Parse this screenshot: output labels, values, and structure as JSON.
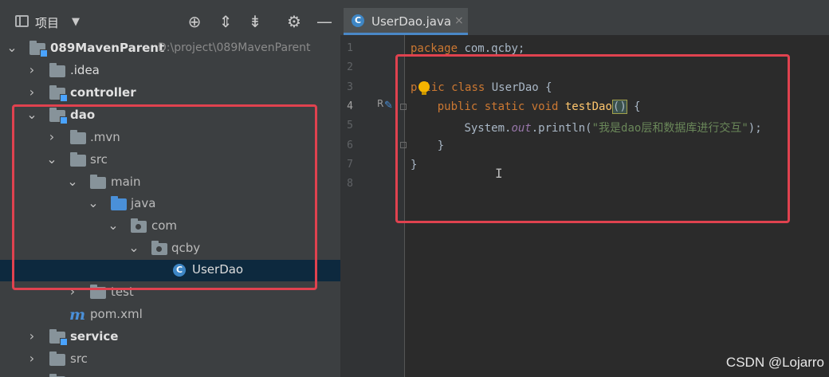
{
  "project_panel": {
    "title": "项目",
    "toolbar_icons": [
      "locate-icon",
      "expand-all-icon",
      "collapse-all-icon",
      "gear-icon",
      "minimize-icon"
    ]
  },
  "tree": {
    "root_label": "089MavenParent",
    "root_path": "D:\\project\\089MavenParent",
    "idea": ".idea",
    "controller": "controller",
    "dao": "dao",
    "mvn": ".mvn",
    "src": "src",
    "main": "main",
    "java": "java",
    "com": "com",
    "qcby": "qcby",
    "userdao": "UserDao",
    "test": "test",
    "pom": "pom.xml",
    "service": "service",
    "src2": "src"
  },
  "editor": {
    "tab_label": "UserDao.java",
    "tab_close": "×",
    "line_numbers": [
      "1",
      "2",
      "3",
      "4",
      "5",
      "6",
      "7",
      "8"
    ],
    "current_line": "4",
    "gutter_marker": "R"
  },
  "code": {
    "l1_kw": "package",
    "l1_rest": " com.qcby;",
    "l3_p": "p",
    "l3_kw": "lic class",
    "l3_rest": " UserDao {",
    "l4_kw": "public static void",
    "l4_name": " testDao",
    "l4_paren_open": "(",
    "l4_paren_close": ")",
    "l4_rest": " {",
    "l5_pre": "System.",
    "l5_out": "out",
    "l5_mid": ".println(",
    "l5_str": "\"我是dao层和数据库进行交互\"",
    "l5_end": ");",
    "l6": "}",
    "l7": "}",
    "cursor": "I"
  },
  "watermark": "CSDN @Lojarro",
  "colors": {
    "highlight_box": "#e0424f",
    "keyword": "#cc7832",
    "string": "#6a8759",
    "selection": "#0d293e"
  }
}
